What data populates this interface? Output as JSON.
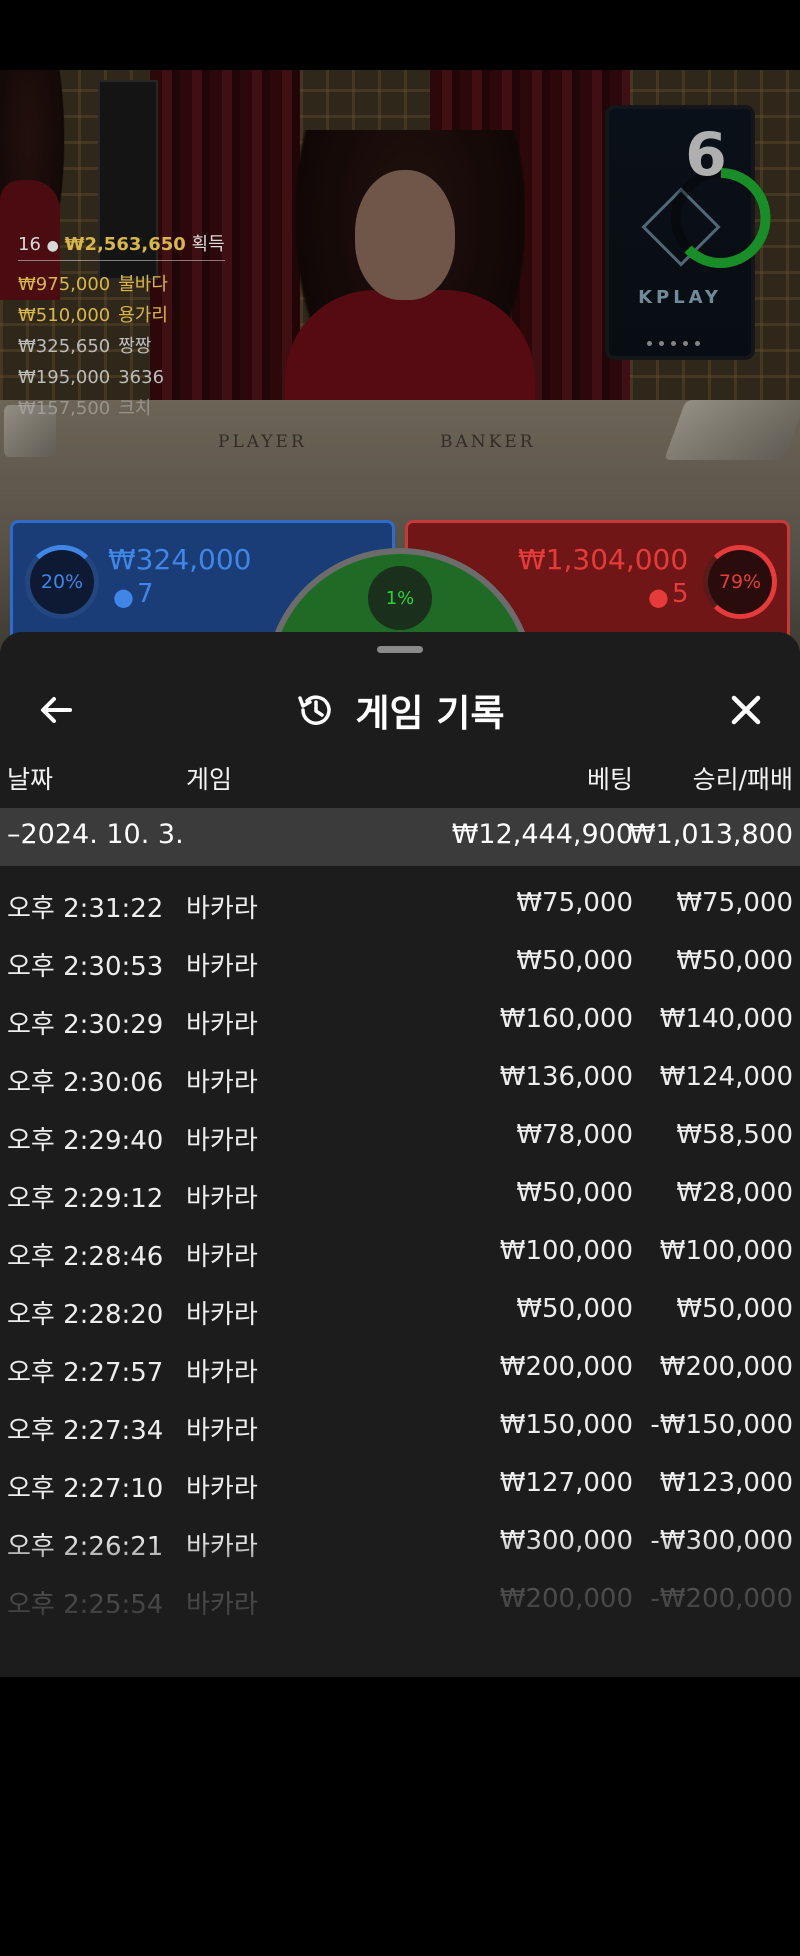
{
  "video": {
    "felt_labels": {
      "player": "PLAYER",
      "banker": "BANKER"
    },
    "screen": {
      "brand": "KPLAY",
      "countdown": "6"
    },
    "winners": {
      "player_count": "16",
      "total": "₩2,563,650",
      "total_suffix": "획득",
      "rows": [
        {
          "amount": "₩975,000",
          "name": "불바다",
          "style": "gold"
        },
        {
          "amount": "₩510,000",
          "name": "용가리",
          "style": "gold"
        },
        {
          "amount": "₩325,650",
          "name": "짱짱",
          "style": "dim"
        },
        {
          "amount": "₩195,000",
          "name": "3636",
          "style": "dim"
        },
        {
          "amount": "₩157,500",
          "name": "크치",
          "style": "faded"
        }
      ]
    },
    "bets": {
      "player": {
        "percent": "20%",
        "amount": "₩324,000",
        "count": "7",
        "color": "#3f86e6"
      },
      "banker": {
        "percent": "79%",
        "amount": "₩1,304,000",
        "count": "5",
        "color": "#e53b3b"
      },
      "tie": {
        "percent": "1%",
        "color": "#2bd33b"
      }
    }
  },
  "history": {
    "title": "게임 기록",
    "columns": {
      "date": "날짜",
      "game": "게임",
      "bet": "베팅",
      "result": "승리/패배"
    },
    "day": {
      "label": "–2024. 10. 3.",
      "bet": "₩12,444,900",
      "result": "₩1,013,800"
    },
    "rows": [
      {
        "time": "오후 2:31:22",
        "game": "바카라",
        "bet": "₩75,000",
        "result": "₩75,000"
      },
      {
        "time": "오후 2:30:53",
        "game": "바카라",
        "bet": "₩50,000",
        "result": "₩50,000"
      },
      {
        "time": "오후 2:30:29",
        "game": "바카라",
        "bet": "₩160,000",
        "result": "₩140,000"
      },
      {
        "time": "오후 2:30:06",
        "game": "바카라",
        "bet": "₩136,000",
        "result": "₩124,000"
      },
      {
        "time": "오후 2:29:40",
        "game": "바카라",
        "bet": "₩78,000",
        "result": "₩58,500"
      },
      {
        "time": "오후 2:29:12",
        "game": "바카라",
        "bet": "₩50,000",
        "result": "₩28,000"
      },
      {
        "time": "오후 2:28:46",
        "game": "바카라",
        "bet": "₩100,000",
        "result": "₩100,000"
      },
      {
        "time": "오후 2:28:20",
        "game": "바카라",
        "bet": "₩50,000",
        "result": "₩50,000"
      },
      {
        "time": "오후 2:27:57",
        "game": "바카라",
        "bet": "₩200,000",
        "result": "₩200,000"
      },
      {
        "time": "오후 2:27:34",
        "game": "바카라",
        "bet": "₩150,000",
        "result": "-₩150,000"
      },
      {
        "time": "오후 2:27:10",
        "game": "바카라",
        "bet": "₩127,000",
        "result": "₩123,000"
      },
      {
        "time": "오후 2:26:21",
        "game": "바카라",
        "bet": "₩300,000",
        "result": "-₩300,000"
      },
      {
        "time": "오후 2:25:54",
        "game": "바카라",
        "bet": "₩200,000",
        "result": "-₩200,000"
      }
    ],
    "icons": {
      "back": "arrow-left-icon",
      "history": "history-clock-icon",
      "close": "close-icon"
    }
  }
}
